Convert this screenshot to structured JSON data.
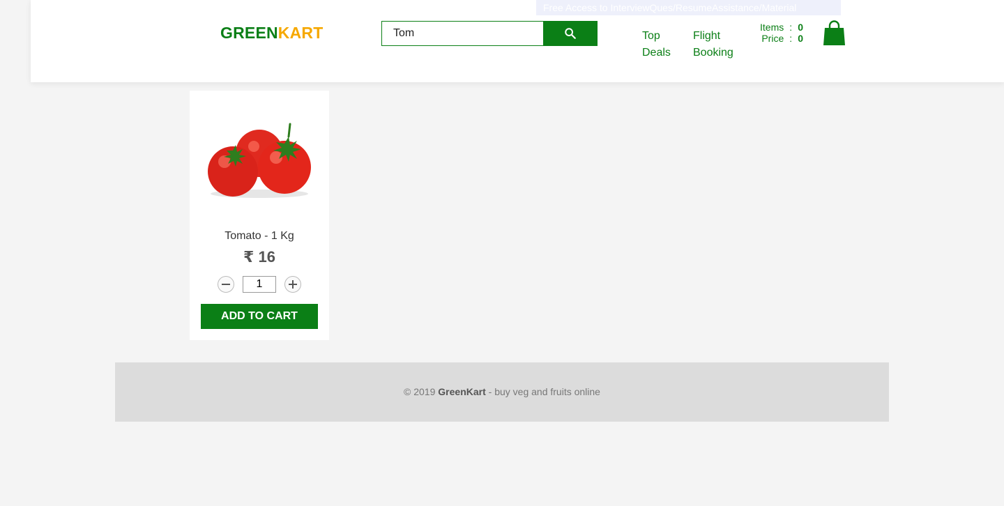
{
  "header": {
    "promo_text": "Free Access to InterviewQues/ResumeAssistance/Material",
    "brand_part1": "GREEN",
    "brand_part2": "KART",
    "search": {
      "value": "Tom"
    },
    "nav": {
      "top_deals": [
        "Top",
        "Deals"
      ],
      "flight_booking": [
        "Flight",
        "Booking"
      ]
    },
    "cart": {
      "items_label": "Items",
      "items_value": "0",
      "price_label": "Price",
      "price_value": "0",
      "separator": ":"
    }
  },
  "product": {
    "name": "Tomato - 1 Kg",
    "price": "₹ 16",
    "quantity": "1",
    "add_to_cart": "ADD TO CART"
  },
  "footer": {
    "prefix": "© 2019",
    "brand": "GreenKart",
    "suffix": "- buy veg and fruits online"
  },
  "colors": {
    "brand_green": "#0b7f16",
    "brand_orange": "#f6a800",
    "background": "#f4f4f4",
    "footer_bg": "#dcdcdc"
  },
  "icons": [
    "search-icon",
    "cart-icon",
    "minus-icon",
    "plus-icon"
  ]
}
